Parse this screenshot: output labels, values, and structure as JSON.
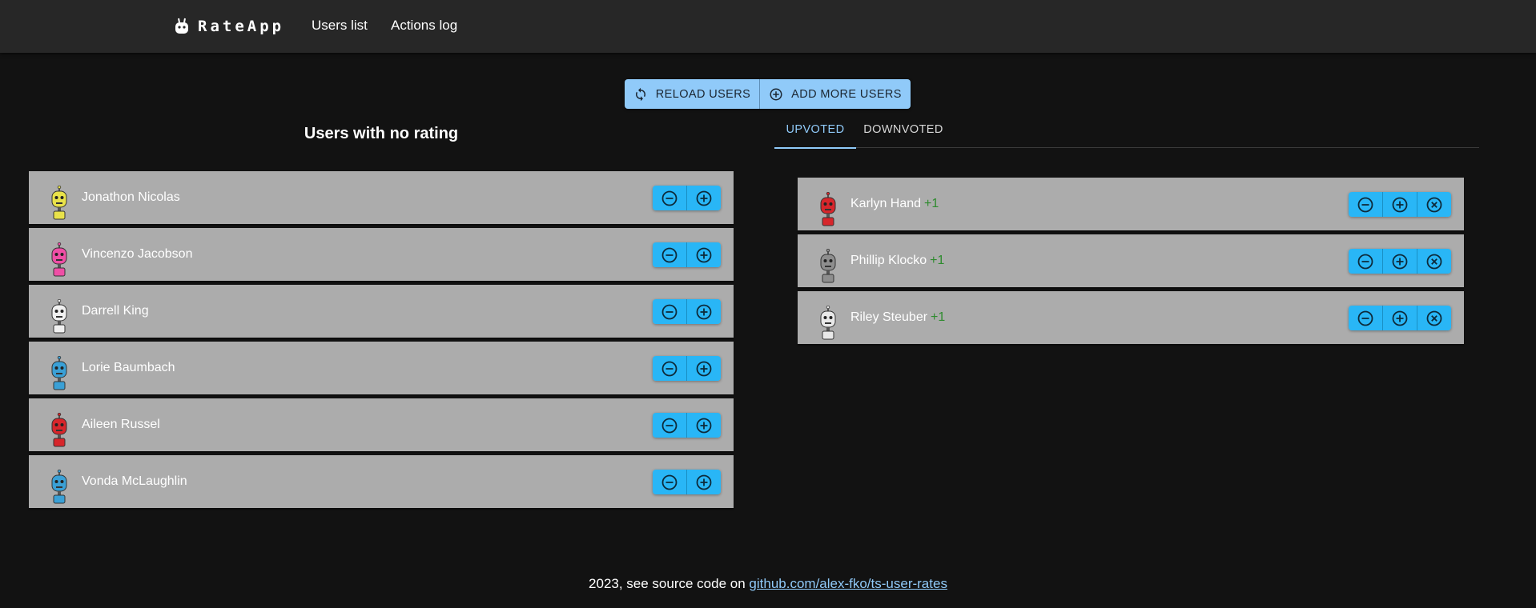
{
  "app": {
    "brand": "RateApp",
    "nav": [
      "Users list",
      "Actions log"
    ]
  },
  "toolbar": {
    "reload_label": "RELOAD USERS",
    "add_label": "ADD MORE USERS"
  },
  "unrated": {
    "title": "Users with no rating",
    "users": [
      {
        "name": "Jonathon Nicolas",
        "avatar_color": "#e9e24a"
      },
      {
        "name": "Vincenzo Jacobson",
        "avatar_color": "#ef4fa6"
      },
      {
        "name": "Darrell King",
        "avatar_color": "#f1f1f1"
      },
      {
        "name": "Lorie Baumbach",
        "avatar_color": "#3aa0d6"
      },
      {
        "name": "Aileen Russel",
        "avatar_color": "#d7262b"
      },
      {
        "name": "Vonda McLaughlin",
        "avatar_color": "#3aa0d6"
      }
    ],
    "actions": [
      "minus-circle-icon",
      "plus-circle-icon"
    ]
  },
  "tabs": {
    "upvoted": "UPVOTED",
    "downvoted": "DOWNVOTED",
    "active": "upvoted"
  },
  "rated": {
    "users": [
      {
        "name": "Karlyn Hand",
        "score": "+1",
        "avatar_color": "#d7262b"
      },
      {
        "name": "Phillip Klocko",
        "score": "+1",
        "avatar_color": "#8e8e8e"
      },
      {
        "name": "Riley Steuber",
        "score": "+1",
        "avatar_color": "#e8e8e8"
      }
    ],
    "actions": [
      "minus-circle-icon",
      "plus-circle-icon",
      "close-circle-icon"
    ]
  },
  "footer": {
    "text": "2023, see source code on ",
    "link": "github.com/alex-fko/ts-user-rates"
  },
  "colors": {
    "background": "#121212",
    "appbar": "#272727",
    "primary_light": "#90caf9",
    "action_button": "#29b6f6",
    "row_bg": "#acacac",
    "score": "#2e8b2e"
  }
}
